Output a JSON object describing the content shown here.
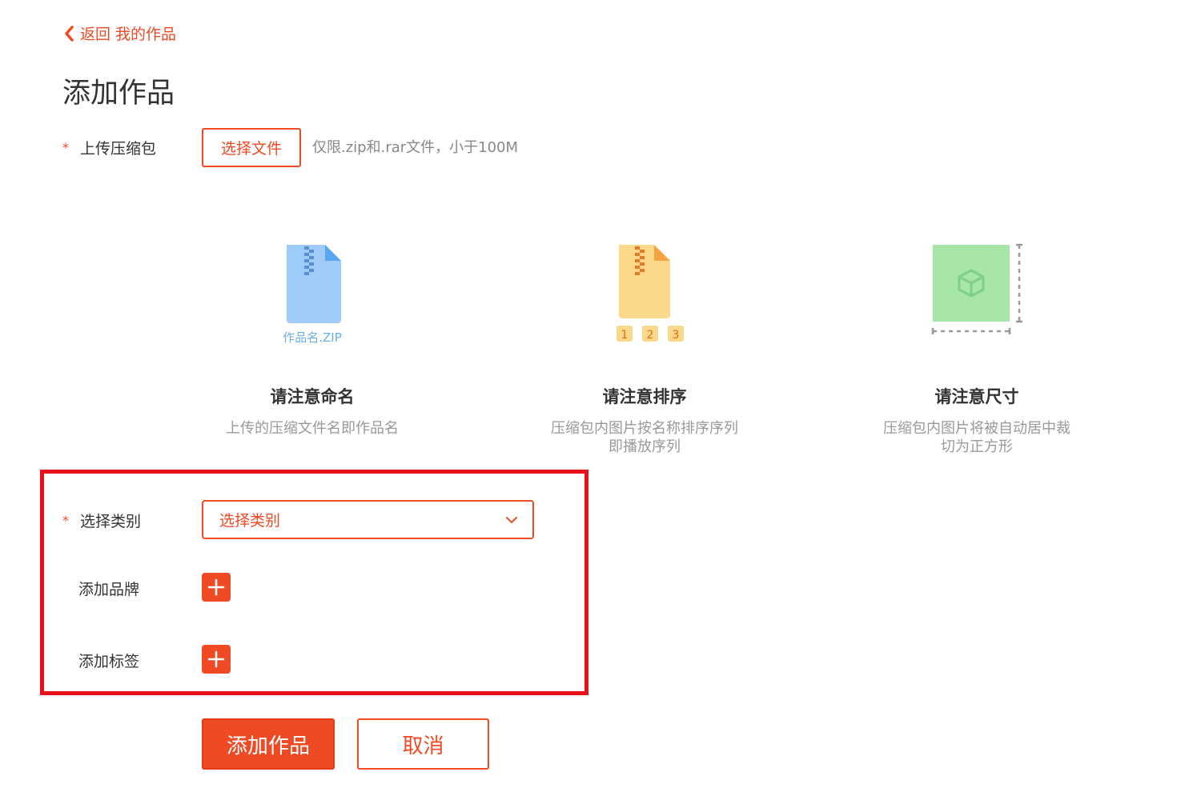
{
  "nav": {
    "back_label": "返回 我的作品"
  },
  "page": {
    "title": "添加作品"
  },
  "upload": {
    "required_mark": "*",
    "label": "上传压缩包",
    "button_label": "选择文件",
    "hint": "仅限.zip和.rar文件，小于100M"
  },
  "tips": [
    {
      "icon": "zip-file-icon",
      "icon_caption": "作品名.ZIP",
      "title": "请注意命名",
      "desc_lines": [
        "上传的压缩文件名即作品名"
      ]
    },
    {
      "icon": "ordered-zip-file-icon",
      "icon_badges": [
        "1",
        "2",
        "3"
      ],
      "title": "请注意排序",
      "desc_lines": [
        "压缩包内图片按名称排序序列",
        "即播放序列"
      ]
    },
    {
      "icon": "square-crop-icon",
      "title": "请注意尺寸",
      "desc_lines": [
        "压缩包内图片将被自动居中裁",
        "切为正方形"
      ]
    }
  ],
  "category": {
    "required_mark": "*",
    "label": "选择类别",
    "select_value": "选择类别"
  },
  "brand": {
    "label": "添加品牌"
  },
  "tag": {
    "label": "添加标签"
  },
  "actions": {
    "submit_label": "添加作品",
    "cancel_label": "取消"
  },
  "colors": {
    "accent": "#f04a24",
    "highlight_border": "#e8101a",
    "zip_blue": "#9ecbf7",
    "zip_yellow": "#fcd98a",
    "crop_green": "#a8e6a8"
  }
}
